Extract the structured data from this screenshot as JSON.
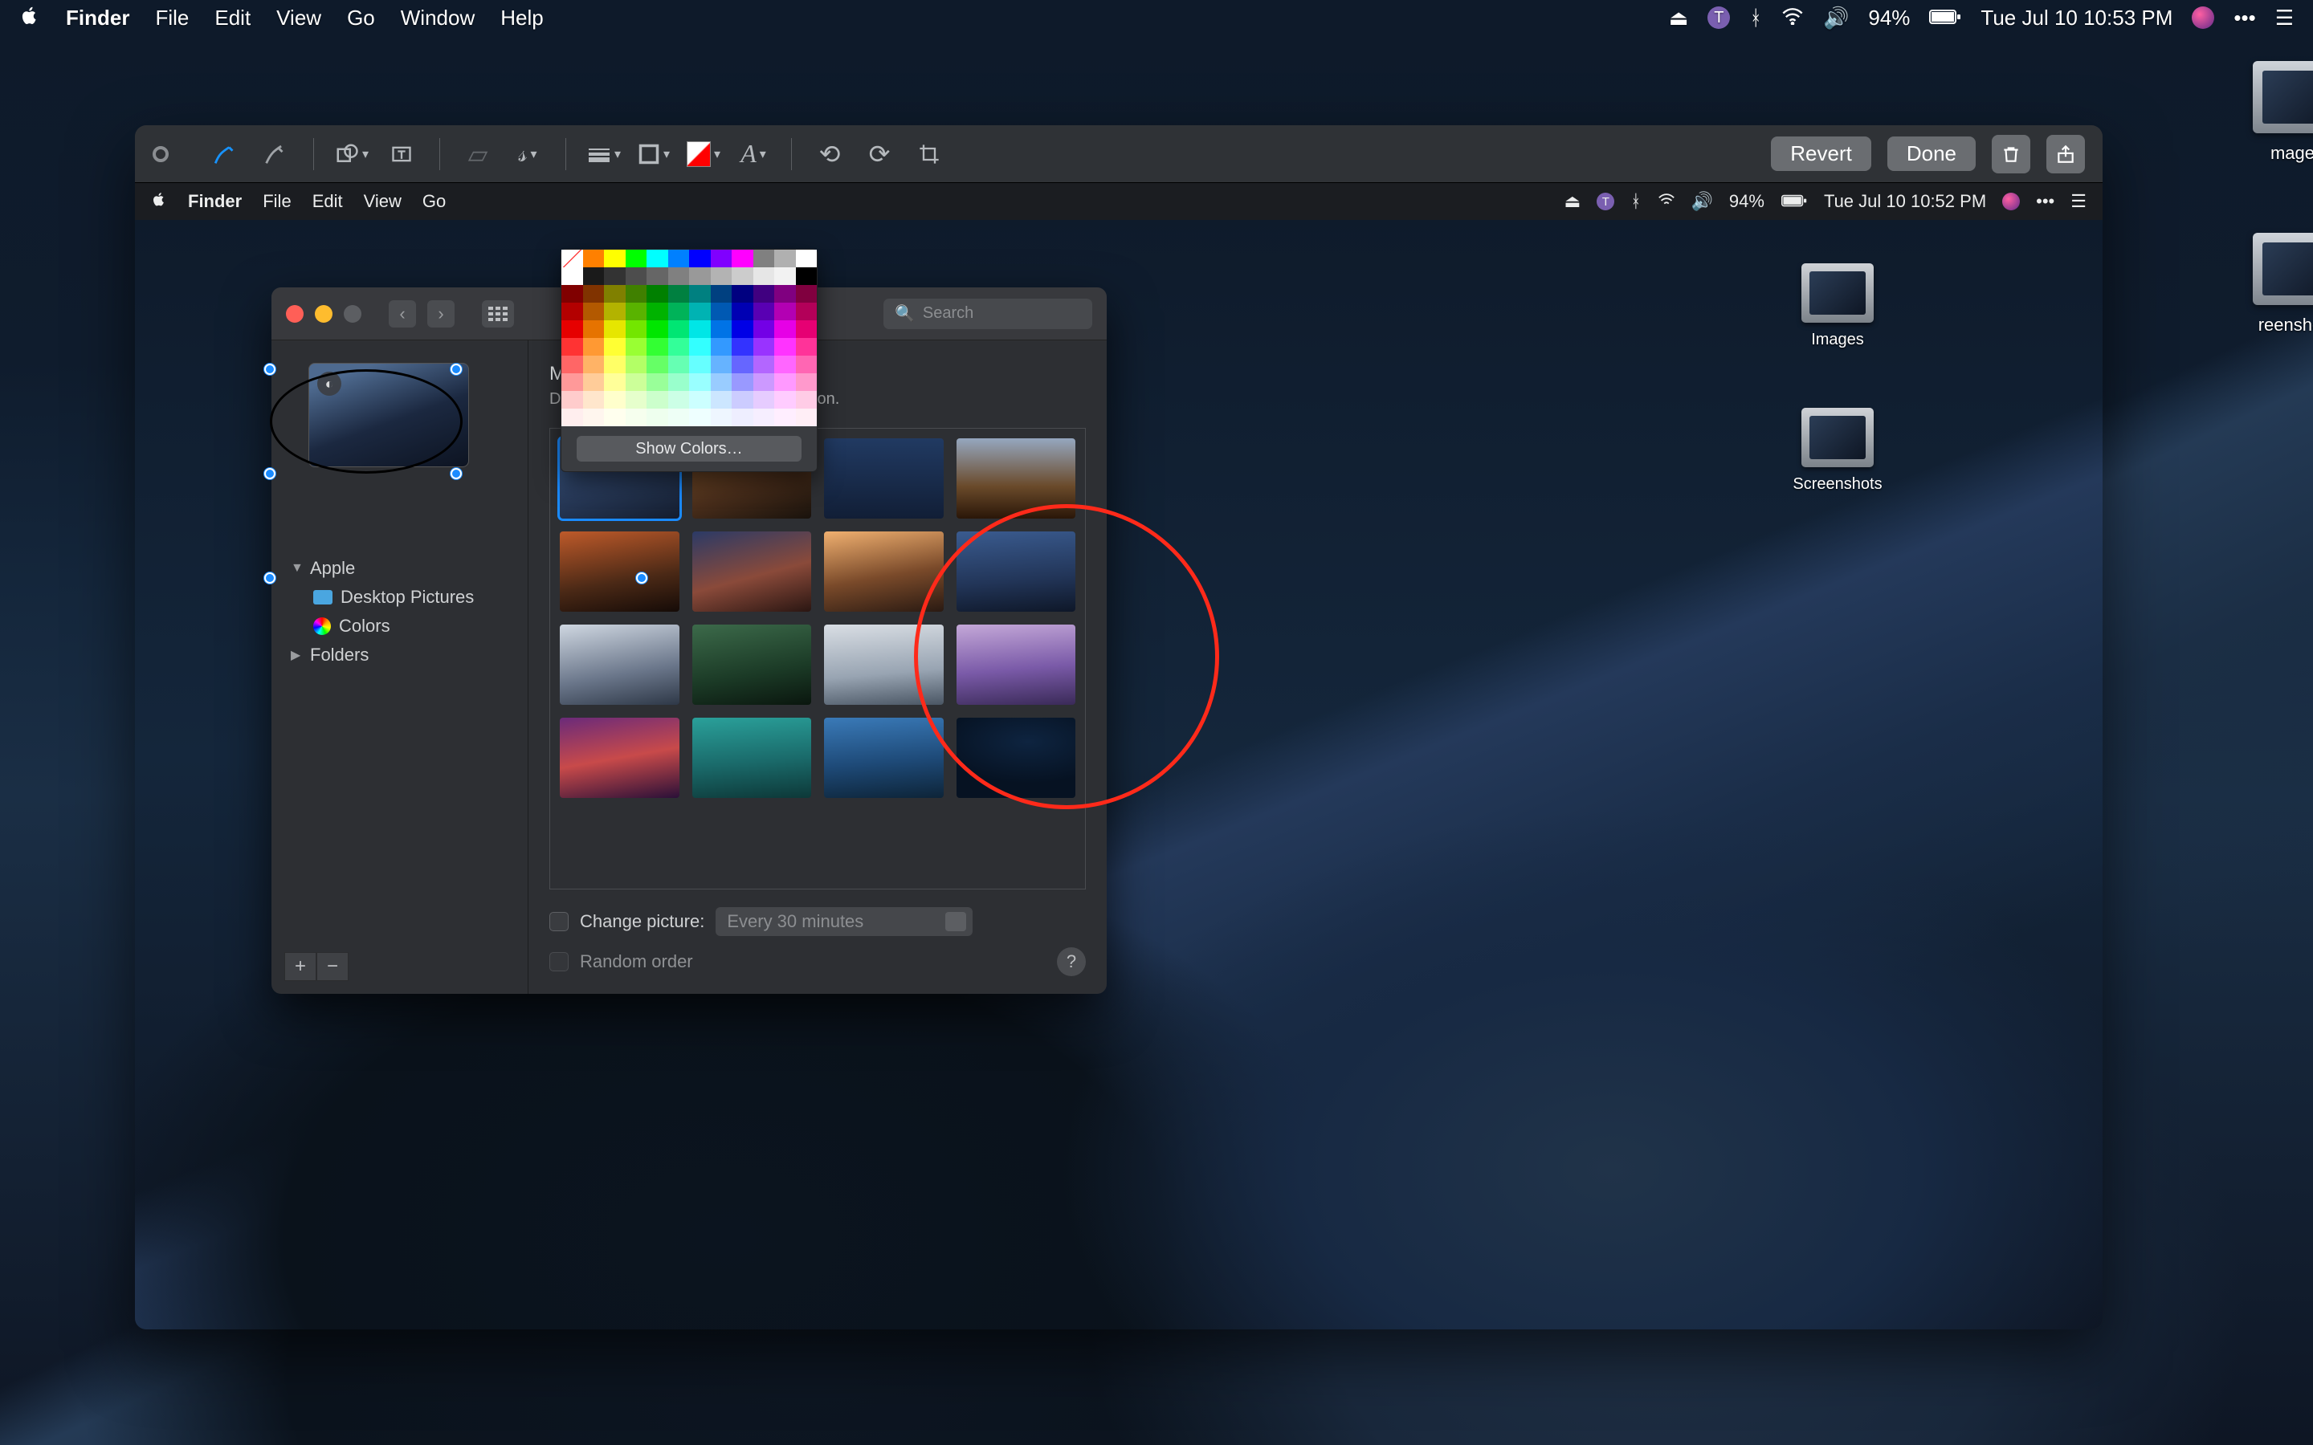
{
  "outer_menubar": {
    "app": "Finder",
    "items": [
      "File",
      "Edit",
      "View",
      "Go",
      "Window",
      "Help"
    ],
    "battery": "94%",
    "datetime": "Tue Jul 10  10:53 PM"
  },
  "desktop_icons": {
    "images": "Images",
    "screenshots": "Screenshots",
    "images_clipped": "mages",
    "screenshots_clipped": "reenshots"
  },
  "markup_toolbar": {
    "revert": "Revert",
    "done": "Done"
  },
  "inner_menubar": {
    "app": "Finder",
    "items": [
      "File",
      "Edit",
      "View",
      "Go"
    ],
    "battery": "94%",
    "datetime": "Tue Jul 10  10:52 PM"
  },
  "prefs": {
    "search_placeholder": "Search",
    "title": "Mojave",
    "subtitle_visible": "Dynamic                                                         the day based on your location.",
    "tree": {
      "apple": "Apple",
      "pictures": "Desktop Pictures",
      "colors": "Colors",
      "folders": "Folders"
    },
    "change_picture": "Change picture:",
    "change_interval": "Every 30 minutes",
    "random_order": "Random order"
  },
  "picker": {
    "show_colors": "Show Colors…",
    "swatches": [
      "#ff0000",
      "#ff8000",
      "#ffff00",
      "#00ff00",
      "#00ffff",
      "#0080ff",
      "#0000ff",
      "#8000ff",
      "#ff00ff",
      "#808080",
      "#b0b0b0",
      "#ffffff",
      "#ffffff",
      "#1a1a1a",
      "#333333",
      "#4d4d4d",
      "#666666",
      "#808080",
      "#999999",
      "#b3b3b3",
      "#cccccc",
      "#e6e6e6",
      "#f2f2f2",
      "#000000",
      "#800000",
      "#803300",
      "#808000",
      "#408000",
      "#008000",
      "#008040",
      "#008080",
      "#004080",
      "#000080",
      "#400080",
      "#800080",
      "#80003f",
      "#b30000",
      "#b35900",
      "#b3b300",
      "#59b300",
      "#00b300",
      "#00b359",
      "#00b3b3",
      "#0059b3",
      "#0000b3",
      "#5900b3",
      "#b300b3",
      "#b30059",
      "#e60000",
      "#e67300",
      "#e6e600",
      "#73e600",
      "#00e600",
      "#00e673",
      "#00e6e6",
      "#0073e6",
      "#0000e6",
      "#7300e6",
      "#e600e6",
      "#e60073",
      "#ff3333",
      "#ff9933",
      "#ffff33",
      "#99ff33",
      "#33ff33",
      "#33ff99",
      "#33ffff",
      "#3399ff",
      "#3333ff",
      "#9933ff",
      "#ff33ff",
      "#ff3399",
      "#ff6666",
      "#ffb366",
      "#ffff66",
      "#b3ff66",
      "#66ff66",
      "#66ffb3",
      "#66ffff",
      "#66b3ff",
      "#6666ff",
      "#b366ff",
      "#ff66ff",
      "#ff66b3",
      "#ff9999",
      "#ffcc99",
      "#ffff99",
      "#ccff99",
      "#99ff99",
      "#99ffcc",
      "#99ffff",
      "#99ccff",
      "#9999ff",
      "#cc99ff",
      "#ff99ff",
      "#ff99cc",
      "#ffcccc",
      "#ffe6cc",
      "#ffffcc",
      "#e6ffcc",
      "#ccffcc",
      "#ccffe6",
      "#ccffff",
      "#cce6ff",
      "#ccccff",
      "#e6ccff",
      "#ffccff",
      "#ffcce6",
      "#ffeeee",
      "#fff6ee",
      "#ffffee",
      "#f6ffee",
      "#eeffee",
      "#eefff6",
      "#eeffff",
      "#eef6ff",
      "#eeeeff",
      "#f6eeff",
      "#ffeeff",
      "#ffeef6"
    ]
  },
  "annotations": {
    "oval_handles": 6
  }
}
